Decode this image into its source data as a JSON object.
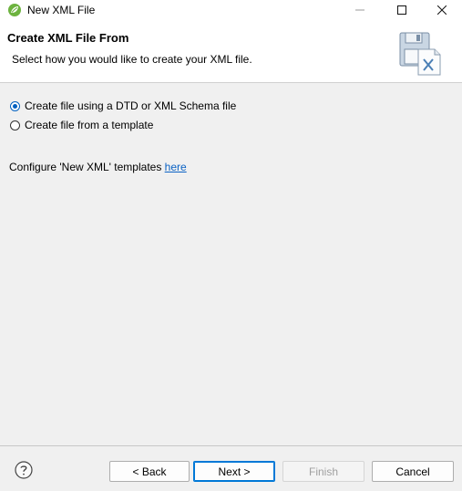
{
  "window": {
    "title": "New XML File"
  },
  "header": {
    "title": "Create XML File From",
    "description": "Select how you would like to create your XML file."
  },
  "options": [
    {
      "label": "Create file using a DTD or XML Schema file",
      "selected": true
    },
    {
      "label": "Create file from a template",
      "selected": false
    }
  ],
  "configure": {
    "text": "Configure 'New XML' templates ",
    "link": "here"
  },
  "buttons": {
    "back": "< Back",
    "next": "Next >",
    "finish": "Finish",
    "cancel": "Cancel"
  },
  "colors": {
    "accent": "#0078d7",
    "link": "#0b62c4",
    "app_icon": "#6db33f"
  }
}
